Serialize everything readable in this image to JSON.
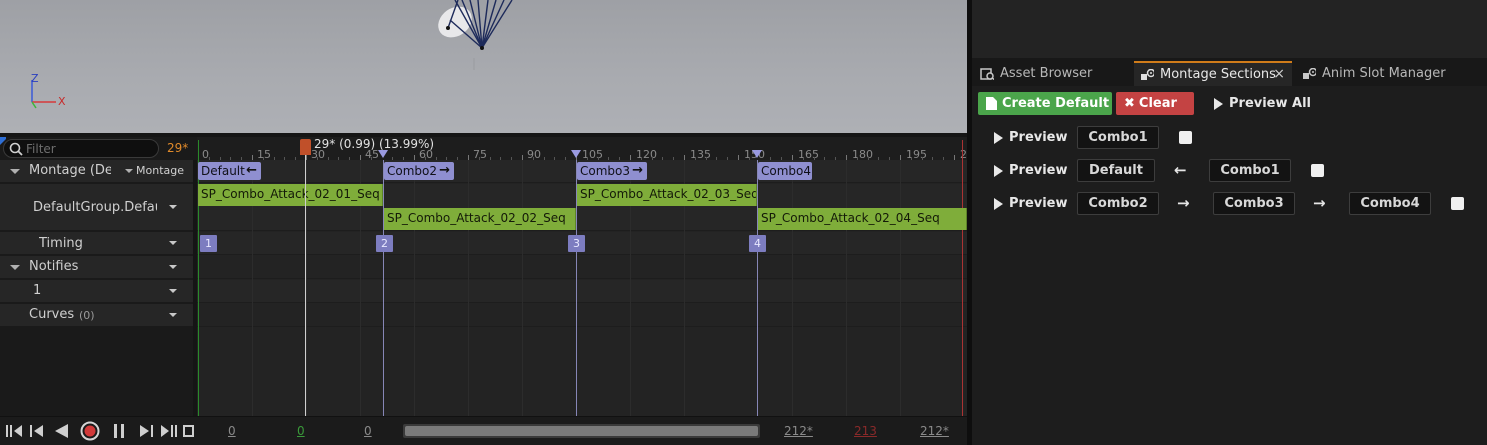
{
  "viewport": {
    "axis_z": "Z",
    "axis_x": "X"
  },
  "filter": {
    "placeholder": "Filter",
    "frame": "29*"
  },
  "tracks": {
    "montage_label": "Montage (Defa",
    "montage_dropdown": "Montage",
    "slot_label": "DefaultGroup.DefaultS",
    "timing_label": "Timing",
    "notifies_label": "Notifies",
    "notify_track_label": "1",
    "curves_label": "Curves",
    "curves_count": "(0)"
  },
  "ruler": {
    "ticks": [
      "0",
      "15",
      "30",
      "45",
      "60",
      "75",
      "90",
      "105",
      "120",
      "135",
      "150",
      "165",
      "180",
      "195",
      "2"
    ],
    "playhead_label": "29* (0.99) (13.99%)"
  },
  "sections": [
    {
      "name": "Default",
      "arrow": "←"
    },
    {
      "name": "Combo2",
      "arrow": "→"
    },
    {
      "name": "Combo3",
      "arrow": "→"
    },
    {
      "name": "Combo4",
      "arrow": ""
    }
  ],
  "sequences": [
    "SP_Combo_Attack_02_01_Seq",
    "SP_Combo_Attack_02_02_Seq",
    "SP_Combo_Attack_02_03_Seq",
    "SP_Combo_Attack_02_04_Seq"
  ],
  "timing_markers": [
    "1",
    "2",
    "3",
    "4"
  ],
  "transport": {
    "start_frame": "0",
    "current_frame": "0",
    "view_start": "0",
    "view_end": "212*",
    "end_frame": "213",
    "total": "212*"
  },
  "tabs": {
    "asset_browser": "Asset Browser",
    "montage_sections": "Montage Sections",
    "anim_slot_manager": "Anim Slot Manager",
    "close": "×"
  },
  "montage_sections_panel": {
    "create_default": "Create Default",
    "clear": "Clear",
    "preview_all": "Preview All",
    "rows": [
      {
        "preview": "Preview",
        "sections": [
          "Combo1"
        ],
        "links": []
      },
      {
        "preview": "Preview",
        "sections": [
          "Default",
          "Combo1"
        ],
        "links": [
          "←"
        ]
      },
      {
        "preview": "Preview",
        "sections": [
          "Combo2",
          "Combo3",
          "Combo4"
        ],
        "links": [
          "→",
          "→"
        ]
      }
    ]
  },
  "colors": {
    "accent_orange": "#e08a2a",
    "section_purple": "#8f8fd0",
    "sequence_green": "#7fad3a",
    "create_green": "#4ba54b",
    "clear_red": "#c44343"
  }
}
